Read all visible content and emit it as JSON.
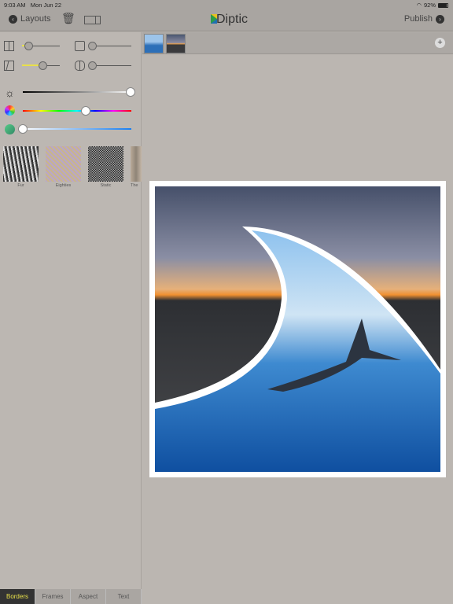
{
  "status": {
    "time": "9:03 AM",
    "date": "Mon Jun 22",
    "battery": "92%"
  },
  "toolbar": {
    "back_label": "Layouts",
    "app_title": "Diptic",
    "publish_label": "Publish"
  },
  "sliders": {
    "border_width": 0.05,
    "curve": 0.5,
    "inner_spacing": 0.05,
    "rounding": 0.05,
    "brightness": 1.0,
    "hue": 0.58,
    "saturation": 0.0
  },
  "textures": [
    {
      "label": "Fur"
    },
    {
      "label": "Eighties"
    },
    {
      "label": "Static"
    },
    {
      "label": "The"
    }
  ],
  "tabs": [
    {
      "label": "Borders",
      "active": true
    },
    {
      "label": "Frames"
    },
    {
      "label": "Aspect"
    },
    {
      "label": "Text"
    }
  ],
  "colors": {
    "accent": "#e8e04a",
    "background": "#bbb6b1"
  }
}
